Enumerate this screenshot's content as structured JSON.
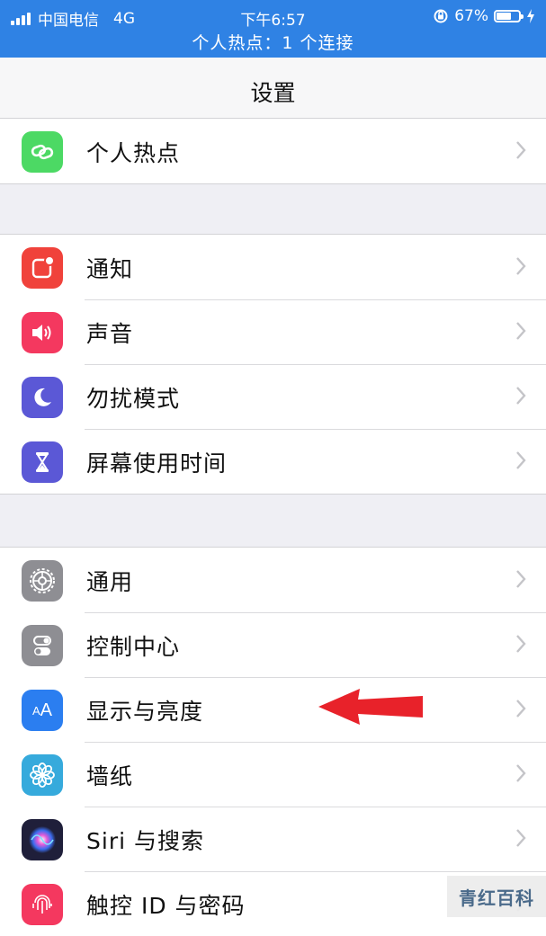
{
  "status_bar": {
    "carrier": "中国电信",
    "network": "4G",
    "time": "下午6:57",
    "battery": "67%",
    "battery_level": 0.67,
    "hotspot_notice": "个人热点：1 个连接"
  },
  "nav": {
    "title": "设置"
  },
  "groups": [
    {
      "items": [
        {
          "label": "个人热点",
          "icon": "hotspot-link-icon",
          "color": "#4cd964"
        }
      ]
    },
    {
      "items": [
        {
          "label": "通知",
          "icon": "notification-icon",
          "color": "#f0423b"
        },
        {
          "label": "声音",
          "icon": "speaker-icon",
          "color": "#f4385f"
        },
        {
          "label": "勿扰模式",
          "icon": "moon-icon",
          "color": "#5b58d6"
        },
        {
          "label": "屏幕使用时间",
          "icon": "hourglass-icon",
          "color": "#5b58d6"
        }
      ]
    },
    {
      "items": [
        {
          "label": "通用",
          "icon": "gear-icon",
          "color": "#8e8e93"
        },
        {
          "label": "控制中心",
          "icon": "toggle-switches-icon",
          "color": "#8e8e93"
        },
        {
          "label": "显示与亮度",
          "icon": "text-size-icon",
          "color": "#2b7ef0"
        },
        {
          "label": "墙纸",
          "icon": "flower-icon",
          "color": "#36aadc"
        },
        {
          "label": "Siri 与搜索",
          "icon": "siri-icon",
          "color": "#1f1f3a"
        },
        {
          "label": "触控 ID 与密码",
          "icon": "fingerprint-icon",
          "color": "#f4385f"
        }
      ]
    }
  ],
  "annotation": {
    "icon": "red-arrow-icon",
    "color": "#e8222a"
  },
  "watermark": "青红百科"
}
